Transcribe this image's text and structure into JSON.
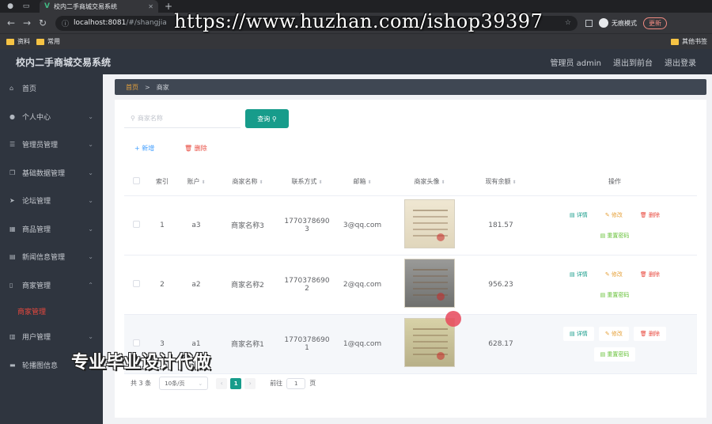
{
  "browser": {
    "tab_title": "校内二手商城交易系统",
    "url_host": "localhost:8081",
    "url_path": "/#/shangjia",
    "incognito_label": "无痕模式",
    "update_label": "更新",
    "bookmarks": [
      "资料",
      "常用"
    ],
    "bookmarks_right": "其他书签",
    "watermark": "https://www.huzhan.com/ishop39397"
  },
  "header": {
    "title": "校内二手商城交易系统",
    "admin": "管理员 admin",
    "exit_front": "退出到前台",
    "logout": "退出登录"
  },
  "sidebar": {
    "items": [
      {
        "label": "首页",
        "icon": "home-icon",
        "arrow": ""
      },
      {
        "label": "个人中心",
        "icon": "user-icon",
        "arrow": "⌄"
      },
      {
        "label": "管理员管理",
        "icon": "list-icon",
        "arrow": "⌄"
      },
      {
        "label": "基础数据管理",
        "icon": "copy-icon",
        "arrow": "⌄"
      },
      {
        "label": "论坛管理",
        "icon": "send-icon",
        "arrow": "⌄"
      },
      {
        "label": "商品管理",
        "icon": "goods-icon",
        "arrow": "⌄"
      },
      {
        "label": "新闻信息管理",
        "icon": "news-icon",
        "arrow": "⌄"
      },
      {
        "label": "商家管理",
        "icon": "phone-icon",
        "arrow": "⌃"
      },
      {
        "label": "用户管理",
        "icon": "book-icon",
        "arrow": "⌄"
      },
      {
        "label": "轮播图信息",
        "icon": "chat-icon",
        "arrow": ""
      }
    ],
    "active_sub": "商家管理"
  },
  "breadcrumb": {
    "home": "首页",
    "sep": ">",
    "current": "商家"
  },
  "toolbar": {
    "search_placeholder": "商家名称",
    "query_label": "查询",
    "add_label": "+ 新增",
    "delete_label": "删除"
  },
  "table": {
    "headers": [
      "索引",
      "账户",
      "商家名称",
      "联系方式",
      "邮箱",
      "商家头像",
      "现有余额",
      "操作"
    ],
    "rows": [
      {
        "index": "1",
        "account": "a3",
        "name": "商家名称3",
        "phone": "17703786903",
        "email": "3@qq.com",
        "balance": "181.57"
      },
      {
        "index": "2",
        "account": "a2",
        "name": "商家名称2",
        "phone": "17703786902",
        "email": "2@qq.com",
        "balance": "956.23"
      },
      {
        "index": "3",
        "account": "a1",
        "name": "商家名称1",
        "phone": "17703786901",
        "email": "1@qq.com",
        "balance": "628.17"
      }
    ],
    "ops": {
      "detail": "详情",
      "edit": "修改",
      "delete": "删除",
      "reset": "重置密码"
    }
  },
  "pagination": {
    "total": "共 3 条",
    "page_size": "10条/页",
    "current": "1",
    "goto_prefix": "前往",
    "goto_value": "1",
    "goto_suffix": "页"
  },
  "overlay": "专业毕业设计代做",
  "colors": {
    "accent": "#179c8b",
    "danger": "#e8483d",
    "warning": "#e6a23c",
    "success": "#67c23a",
    "sidebar": "#2f353f"
  }
}
